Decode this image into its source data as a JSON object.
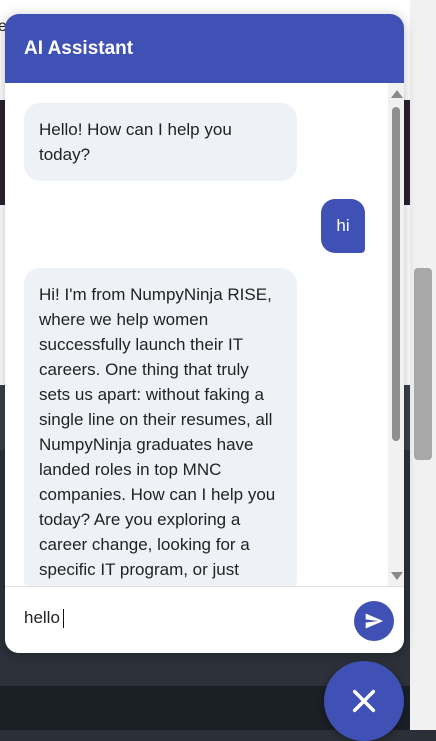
{
  "background_page": {
    "partial_text": "e"
  },
  "chat": {
    "title": "AI Assistant",
    "messages": [
      {
        "sender": "bot",
        "text": "Hello! How can I help you today?"
      },
      {
        "sender": "user",
        "text": "hi"
      },
      {
        "sender": "bot",
        "text": "Hi! I'm from NumpyNinja RISE, where we help women successfully launch their IT careers. One thing that truly sets us apart: without faking a single line on their resumes, all NumpyNinja graduates have landed roles in top MNC companies. How can I help you today? Are you exploring a career change, looking for a specific IT program, or just"
      }
    ],
    "input": {
      "value": "hello"
    }
  },
  "icons": {
    "send": "send-icon",
    "close": "close-icon"
  },
  "colors": {
    "accent": "#3f51b5",
    "bot_bubble": "#eef2f7"
  }
}
